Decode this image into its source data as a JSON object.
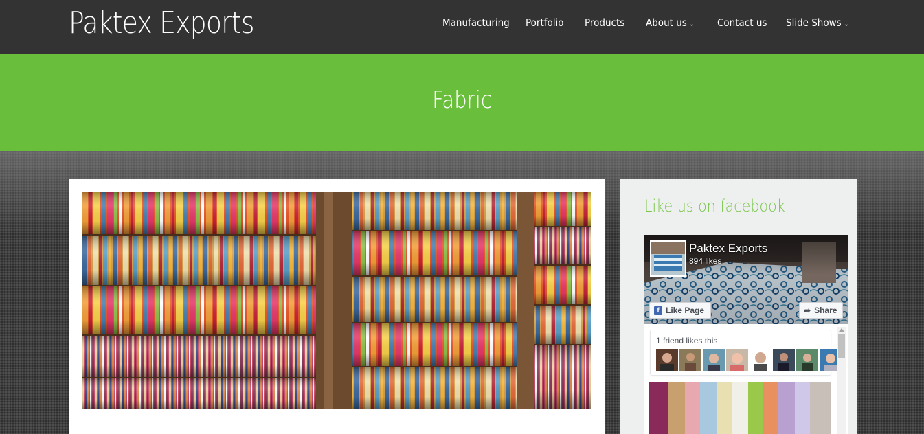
{
  "header": {
    "logo": "Paktex Exports",
    "nav": [
      {
        "label": "Manufacturing",
        "has_dropdown": false
      },
      {
        "label": "Portfolio",
        "has_dropdown": false
      },
      {
        "label": "Products",
        "has_dropdown": false
      },
      {
        "label": "About us",
        "has_dropdown": true
      },
      {
        "label": "Contact us",
        "has_dropdown": false
      },
      {
        "label": "Slide Shows",
        "has_dropdown": true
      }
    ]
  },
  "title_band": {
    "title": "Fabric",
    "color": "#69bf3b"
  },
  "main": {
    "image": "colorful-striped-fabric-rolls-image"
  },
  "sidebar": {
    "title": "Like us on facebook",
    "facebook": {
      "page_name": "Paktex Exports",
      "likes": "894 likes",
      "like_button": "Like Page",
      "share_button": "Share",
      "friends_text": "1 friend likes this",
      "friend_faces_count": 8
    }
  },
  "colors": {
    "header_bg": "#333333",
    "accent_green": "#69bf3b",
    "sidebar_title": "#7cc64f",
    "facebook_blue": "#4267b2"
  },
  "icons": {
    "dropdown": "chevron-down-icon",
    "facebook": "facebook-logo-icon",
    "share": "share-arrow-icon"
  }
}
